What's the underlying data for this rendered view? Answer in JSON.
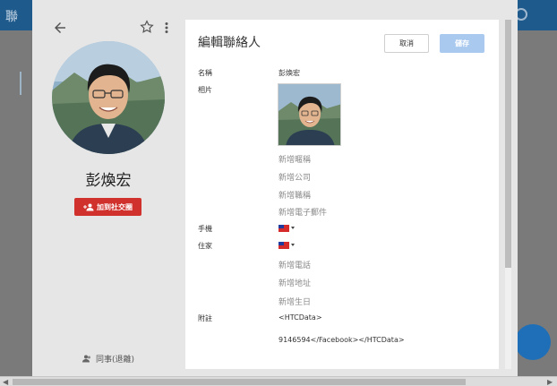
{
  "background": {
    "app_title": "聯"
  },
  "dialog": {
    "contact_name": "彭煥宏",
    "add_social_label": "加到社交圈",
    "group_label": "同事(退離)",
    "form": {
      "title": "編輯聯絡人",
      "cancel_label": "取消",
      "save_label": "儲存",
      "fields": {
        "name_label": "名稱",
        "name_value": "彭煥宏",
        "photo_label": "相片",
        "nickname_placeholder": "新增暱稱",
        "company_placeholder": "新增公司",
        "title_placeholder": "新增職稱",
        "email_placeholder": "新增電子郵件",
        "mobile_label": "手機",
        "home_label": "住家",
        "phone_placeholder": "新增電話",
        "address_placeholder": "新增地址",
        "birthday_placeholder": "新增生日",
        "notes_label": "附註",
        "notes_line1": "<HTCData>",
        "notes_line2": "9146594</Facebook></HTCData>"
      }
    }
  },
  "colors": {
    "header_blue": "#1f5a8c",
    "social_red": "#d0312d",
    "save_disabled": "#a9c9ef"
  }
}
